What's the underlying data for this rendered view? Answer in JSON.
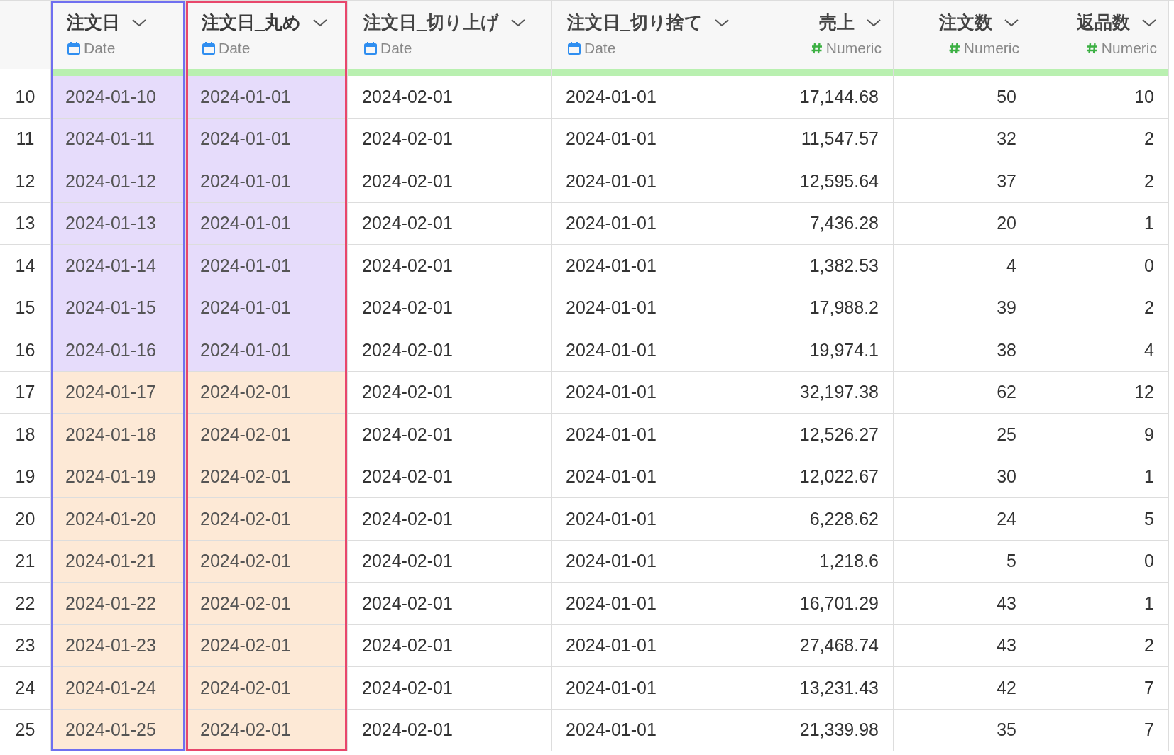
{
  "table": {
    "columns": [
      {
        "name": "注文日",
        "type": "Date",
        "kind": "date",
        "selected": true,
        "color": "#6f6ff0"
      },
      {
        "name": "注文日_丸め",
        "type": "Date",
        "kind": "date",
        "selected": true,
        "color": "#e8476c"
      },
      {
        "name": "注文日_切り上げ",
        "type": "Date",
        "kind": "date",
        "selected": false
      },
      {
        "name": "注文日_切り捨て",
        "type": "Date",
        "kind": "date",
        "selected": false
      },
      {
        "name": "売上",
        "type": "Numeric",
        "kind": "numeric",
        "selected": false
      },
      {
        "name": "注文数",
        "type": "Numeric",
        "kind": "numeric",
        "selected": false
      },
      {
        "name": "返品数",
        "type": "Numeric",
        "kind": "numeric",
        "selected": false
      }
    ],
    "rows": [
      {
        "number": "10",
        "color": "#e6dcfb",
        "cells": [
          "2024-01-10",
          "2024-01-01",
          "2024-02-01",
          "2024-01-01",
          "17,144.68",
          "50",
          "10"
        ]
      },
      {
        "number": "11",
        "color": "#e6dcfb",
        "cells": [
          "2024-01-11",
          "2024-01-01",
          "2024-02-01",
          "2024-01-01",
          "11,547.57",
          "32",
          "2"
        ]
      },
      {
        "number": "12",
        "color": "#e6dcfb",
        "cells": [
          "2024-01-12",
          "2024-01-01",
          "2024-02-01",
          "2024-01-01",
          "12,595.64",
          "37",
          "2"
        ]
      },
      {
        "number": "13",
        "color": "#e6dcfb",
        "cells": [
          "2024-01-13",
          "2024-01-01",
          "2024-02-01",
          "2024-01-01",
          "7,436.28",
          "20",
          "1"
        ]
      },
      {
        "number": "14",
        "color": "#e6dcfb",
        "cells": [
          "2024-01-14",
          "2024-01-01",
          "2024-02-01",
          "2024-01-01",
          "1,382.53",
          "4",
          "0"
        ]
      },
      {
        "number": "15",
        "color": "#e6dcfb",
        "cells": [
          "2024-01-15",
          "2024-01-01",
          "2024-02-01",
          "2024-01-01",
          "17,988.2",
          "39",
          "2"
        ]
      },
      {
        "number": "16",
        "color": "#e6dcfb",
        "cells": [
          "2024-01-16",
          "2024-01-01",
          "2024-02-01",
          "2024-01-01",
          "19,974.1",
          "38",
          "4"
        ]
      },
      {
        "number": "17",
        "color": "#fde9d6",
        "cells": [
          "2024-01-17",
          "2024-02-01",
          "2024-02-01",
          "2024-01-01",
          "32,197.38",
          "62",
          "12"
        ]
      },
      {
        "number": "18",
        "color": "#fde9d6",
        "cells": [
          "2024-01-18",
          "2024-02-01",
          "2024-02-01",
          "2024-01-01",
          "12,526.27",
          "25",
          "9"
        ]
      },
      {
        "number": "19",
        "color": "#fde9d6",
        "cells": [
          "2024-01-19",
          "2024-02-01",
          "2024-02-01",
          "2024-01-01",
          "12,022.67",
          "30",
          "1"
        ]
      },
      {
        "number": "20",
        "color": "#fde9d6",
        "cells": [
          "2024-01-20",
          "2024-02-01",
          "2024-02-01",
          "2024-01-01",
          "6,228.62",
          "24",
          "5"
        ]
      },
      {
        "number": "21",
        "color": "#fde9d6",
        "cells": [
          "2024-01-21",
          "2024-02-01",
          "2024-02-01",
          "2024-01-01",
          "1,218.6",
          "5",
          "0"
        ]
      },
      {
        "number": "22",
        "color": "#fde9d6",
        "cells": [
          "2024-01-22",
          "2024-02-01",
          "2024-02-01",
          "2024-01-01",
          "16,701.29",
          "43",
          "1"
        ]
      },
      {
        "number": "23",
        "color": "#fde9d6",
        "cells": [
          "2024-01-23",
          "2024-02-01",
          "2024-02-01",
          "2024-01-01",
          "27,468.74",
          "43",
          "2"
        ]
      },
      {
        "number": "24",
        "color": "#fde9d6",
        "cells": [
          "2024-01-24",
          "2024-02-01",
          "2024-02-01",
          "2024-01-01",
          "13,231.43",
          "42",
          "7"
        ]
      },
      {
        "number": "25",
        "color": "#fde9d6",
        "cells": [
          "2024-01-25",
          "2024-02-01",
          "2024-02-01",
          "2024-01-01",
          "21,339.98",
          "35",
          "7"
        ]
      }
    ]
  }
}
